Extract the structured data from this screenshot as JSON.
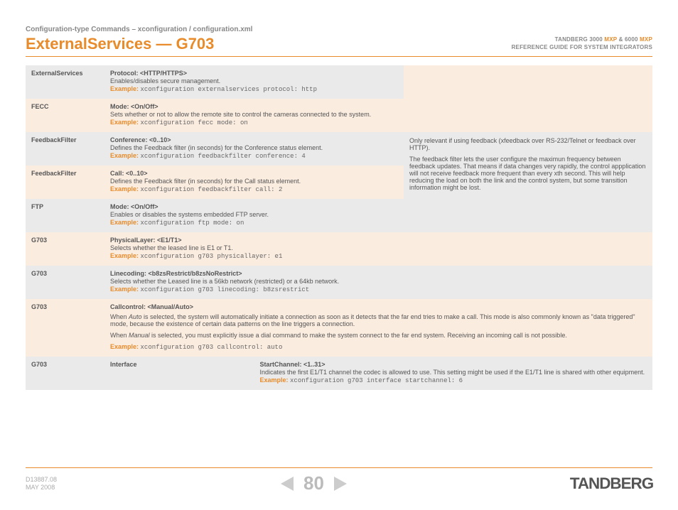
{
  "header": {
    "breadcrumb": "Configuration-type Commands – xconfiguration / configuration.xml",
    "title": "ExternalServices — G703",
    "right_line1_a": "TANDBERG 3000",
    "right_line1_mxp1": "MXP",
    "right_line1_amp": " & 6000",
    "right_line1_mxp2": "MXP",
    "right_line2": "REFERENCE GUIDE FOR SYSTEM INTEGRATORS"
  },
  "rows": {
    "r0": {
      "label": "ExternalServices",
      "param": "Protocol: <HTTP/HTTPS>",
      "desc": "Enables/disables secure management.",
      "ex": "Example: ",
      "code": "xconfiguration externalservices protocol: http"
    },
    "r1": {
      "label": "FECC",
      "param": "Mode: <On/Off>",
      "desc": "Sets whether or not to allow the remote site to control the cameras connected to the system.",
      "ex": "Example: ",
      "code": "xconfiguration fecc mode: on"
    },
    "r2": {
      "label": "FeedbackFilter",
      "param": "Conference: <0..10>",
      "desc": "Defines the Feedback filter (in seconds) for the Conference status element.",
      "ex": "Example: ",
      "code": "xconfiguration feedbackfilter conference: 4"
    },
    "r3": {
      "label": "FeedbackFilter",
      "param": "Call: <0..10>",
      "desc": "Defines the Feedback filter (in seconds) for the Call status element.",
      "ex": "Example: ",
      "code": "xconfiguration feedbackfilter call: 2"
    },
    "side": {
      "p1": "Only relevant if using feedback (xfeedback over RS-232/Telnet or feedback over HTTP).",
      "p2": "The feedback filter lets the user configure the maximun frequency between feedback updates. That means if data changes very rapidly, the control appplication will not receive feedback more frequent than every xth second. This will help reducing the load on both the link and the control system, but some transition information might be lost."
    },
    "r4": {
      "label": "FTP",
      "param": "Mode: <On/Off>",
      "desc": "Enables or disables the systems embedded FTP server.",
      "ex": "Example: ",
      "code": "xconfiguration ftp mode: on"
    },
    "r5": {
      "label": "G703",
      "param": "PhysicalLayer: <E1/T1>",
      "desc": "Selects whether the leased line is E1 or T1.",
      "ex": "Example: ",
      "code": "xconfiguration g703 physicallayer: e1"
    },
    "r6": {
      "label": "G703",
      "param": "Linecoding: <b8zsRestrict/b8zsNoRestrict>",
      "desc": "Selects whether the Leased line is a 56kb network (restricted) or a 64kb network.",
      "ex": "Example: ",
      "code": "xconfiguration g703 linecoding: b8zsrestrict"
    },
    "r7": {
      "label": "G703",
      "param": "Callcontrol: <Manual/Auto>",
      "desc1a": "When ",
      "desc1i": "Auto",
      "desc1b": " is selected, the system will automatically initiate a connection as soon as it detects that the far end tries to make a call. This mode is also commonly known as \"data triggered\" mode, because the existence of certain data patterns on the line triggers a connection.",
      "desc2a": "When ",
      "desc2i": "Manual",
      "desc2b": " is selected, you must explicitly issue a dial command to make the system connect to the far end system. Receiving an incoming call is not possible.",
      "ex": "Example: ",
      "code": "xconfiguration g703 callcontrol: auto"
    },
    "r8": {
      "label": "G703",
      "mid": "Interface",
      "param": "StartChannel: <1..31>",
      "desc": "Indicates the first E1/T1 channel the codec is allowed to use. This setting might be used if the E1/T1 line is shared with other equipment.",
      "ex": "Example: ",
      "code": "xconfiguration g703 interface startchannel: 6"
    }
  },
  "footer": {
    "doc": "D13887.08",
    "date": "MAY 2008",
    "page": "80",
    "logo": "TANDBERG"
  }
}
